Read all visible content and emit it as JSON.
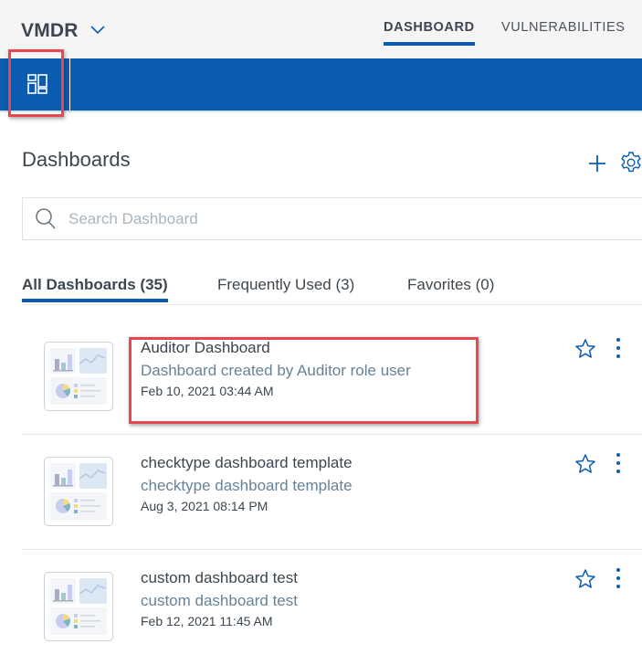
{
  "header": {
    "app_title": "VMDR",
    "nav_tabs": [
      {
        "label": "DASHBOARD",
        "active": true
      },
      {
        "label": "VULNERABILITIES",
        "active": false
      }
    ]
  },
  "toolbar": {
    "dashboard_icon": "dashboard-layout-icon"
  },
  "panel": {
    "title": "Dashboards",
    "add_icon": "plus-icon",
    "settings_icon": "gear-icon",
    "search": {
      "placeholder": "Search Dashboard",
      "value": ""
    },
    "tabs": [
      {
        "label": "All Dashboards (35)",
        "active": true
      },
      {
        "label": "Frequently Used (3)",
        "active": false
      },
      {
        "label": "Favorites (0)",
        "active": false
      }
    ],
    "dashboards": [
      {
        "title": "Auditor Dashboard",
        "description": "Dashboard created by Auditor role user",
        "date": "Feb 10, 2021 03:44 AM",
        "favorite": false
      },
      {
        "title": "checktype dashboard template",
        "description": "checktype dashboard template",
        "date": "Aug 3, 2021 08:14 PM",
        "favorite": false
      },
      {
        "title": "custom dashboard test",
        "description": "custom dashboard test",
        "date": "Feb 12, 2021 11:45 AM",
        "favorite": false
      }
    ]
  },
  "colors": {
    "brand_blue": "#0b5cb0",
    "highlight_red": "#e9464f",
    "description_text": "#688396"
  }
}
